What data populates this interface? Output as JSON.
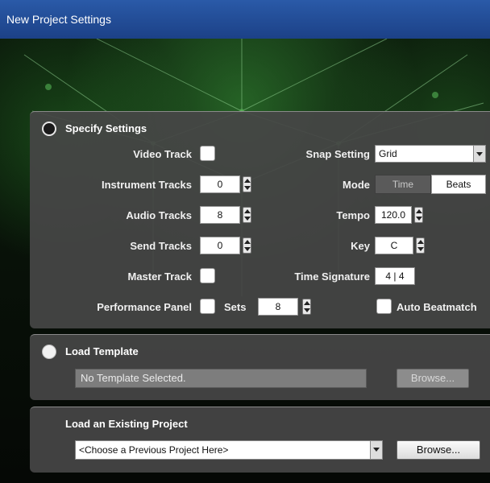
{
  "window": {
    "title": "New Project Settings"
  },
  "specify": {
    "heading": "Specify Settings",
    "video_track_label": "Video Track",
    "instrument_tracks_label": "Instrument Tracks",
    "instrument_tracks_value": "0",
    "audio_tracks_label": "Audio Tracks",
    "audio_tracks_value": "8",
    "send_tracks_label": "Send Tracks",
    "send_tracks_value": "0",
    "master_track_label": "Master Track",
    "performance_panel_label": "Performance Panel",
    "sets_label": "Sets",
    "sets_value": "8",
    "snap_setting_label": "Snap Setting",
    "snap_setting_value": "Grid",
    "mode_label": "Mode",
    "mode_time": "Time",
    "mode_beats": "Beats",
    "tempo_label": "Tempo",
    "tempo_value": "120.0",
    "key_label": "Key",
    "key_value": "C",
    "time_signature_label": "Time Signature",
    "time_signature_value": "4 | 4",
    "auto_beatmatch_label": "Auto Beatmatch"
  },
  "template": {
    "heading": "Load Template",
    "field_value": "No Template Selected.",
    "browse_label": "Browse..."
  },
  "existing": {
    "heading": "Load an Existing Project",
    "select_value": "<Choose a Previous Project Here>",
    "browse_label": "Browse..."
  },
  "colors": {
    "titlebar": "#2a5aa8",
    "panel": "#464646",
    "background_accent": "#3ca03c"
  }
}
